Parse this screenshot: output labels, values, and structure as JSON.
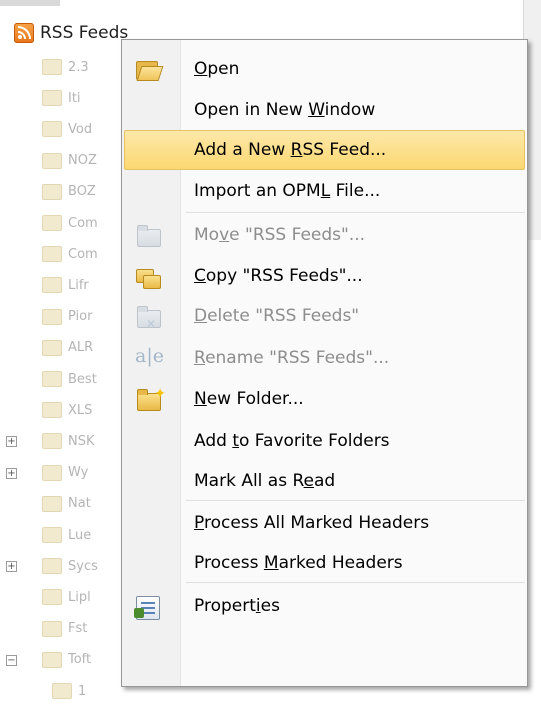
{
  "tree": {
    "root_label": "RSS Feeds",
    "items": [
      "2.3",
      "Iti",
      "Vod",
      "NOZ",
      "BOZ",
      "Com",
      "Com",
      "Lifr",
      "Pior",
      "ALR",
      "Best",
      "XLS",
      "NSK",
      "Wy",
      "Nat",
      "Lue",
      "Sycs",
      "Lipl",
      "Fst",
      "Toft",
      "1"
    ]
  },
  "menu": {
    "items": [
      {
        "id": "open",
        "pre": "",
        "key": "O",
        "post": "pen",
        "icon": "folder-open-icon",
        "disabled": false
      },
      {
        "id": "open-new-window",
        "pre": "Open in New ",
        "key": "W",
        "post": "indow",
        "icon": "",
        "disabled": false
      },
      {
        "id": "add-rss-feed",
        "pre": "Add a New ",
        "key": "R",
        "post": "SS Feed...",
        "icon": "",
        "disabled": false,
        "highlighted": true
      },
      {
        "id": "import-opml",
        "pre": "Import an OPM",
        "key": "L",
        "post": " File...",
        "icon": "",
        "disabled": false
      },
      {
        "id": "move",
        "pre": "Mo",
        "key": "v",
        "post": "e \"RSS Feeds\"...",
        "icon": "move-folder-icon",
        "disabled": true
      },
      {
        "id": "copy",
        "pre": "",
        "key": "C",
        "post": "opy \"RSS Feeds\"...",
        "icon": "copy-folder-icon",
        "disabled": false
      },
      {
        "id": "delete",
        "pre": "",
        "key": "D",
        "post": "elete \"RSS Feeds\"",
        "icon": "delete-folder-icon",
        "disabled": true
      },
      {
        "id": "rename",
        "pre": "",
        "key": "R",
        "post": "ename \"RSS Feeds\"...",
        "icon": "rename-icon",
        "disabled": true
      },
      {
        "id": "new-folder",
        "pre": "",
        "key": "N",
        "post": "ew Folder...",
        "icon": "new-folder-icon",
        "disabled": false
      },
      {
        "id": "add-favorites",
        "pre": "Add ",
        "key": "t",
        "post": "o Favorite Folders",
        "icon": "",
        "disabled": false
      },
      {
        "id": "mark-all-read",
        "pre": "Mark All as R",
        "key": "e",
        "post": "ad",
        "icon": "",
        "disabled": false
      },
      {
        "id": "process-all-marked",
        "pre": "",
        "key": "P",
        "post": "rocess All Marked Headers",
        "icon": "",
        "disabled": false
      },
      {
        "id": "process-marked",
        "pre": "Process ",
        "key": "M",
        "post": "arked Headers",
        "icon": "",
        "disabled": false
      },
      {
        "id": "properties",
        "pre": "Propert",
        "key": "i",
        "post": "es",
        "icon": "properties-icon",
        "disabled": false
      }
    ]
  },
  "colors": {
    "highlight": "#fbd872",
    "disabled_text": "#8d8d8d"
  }
}
